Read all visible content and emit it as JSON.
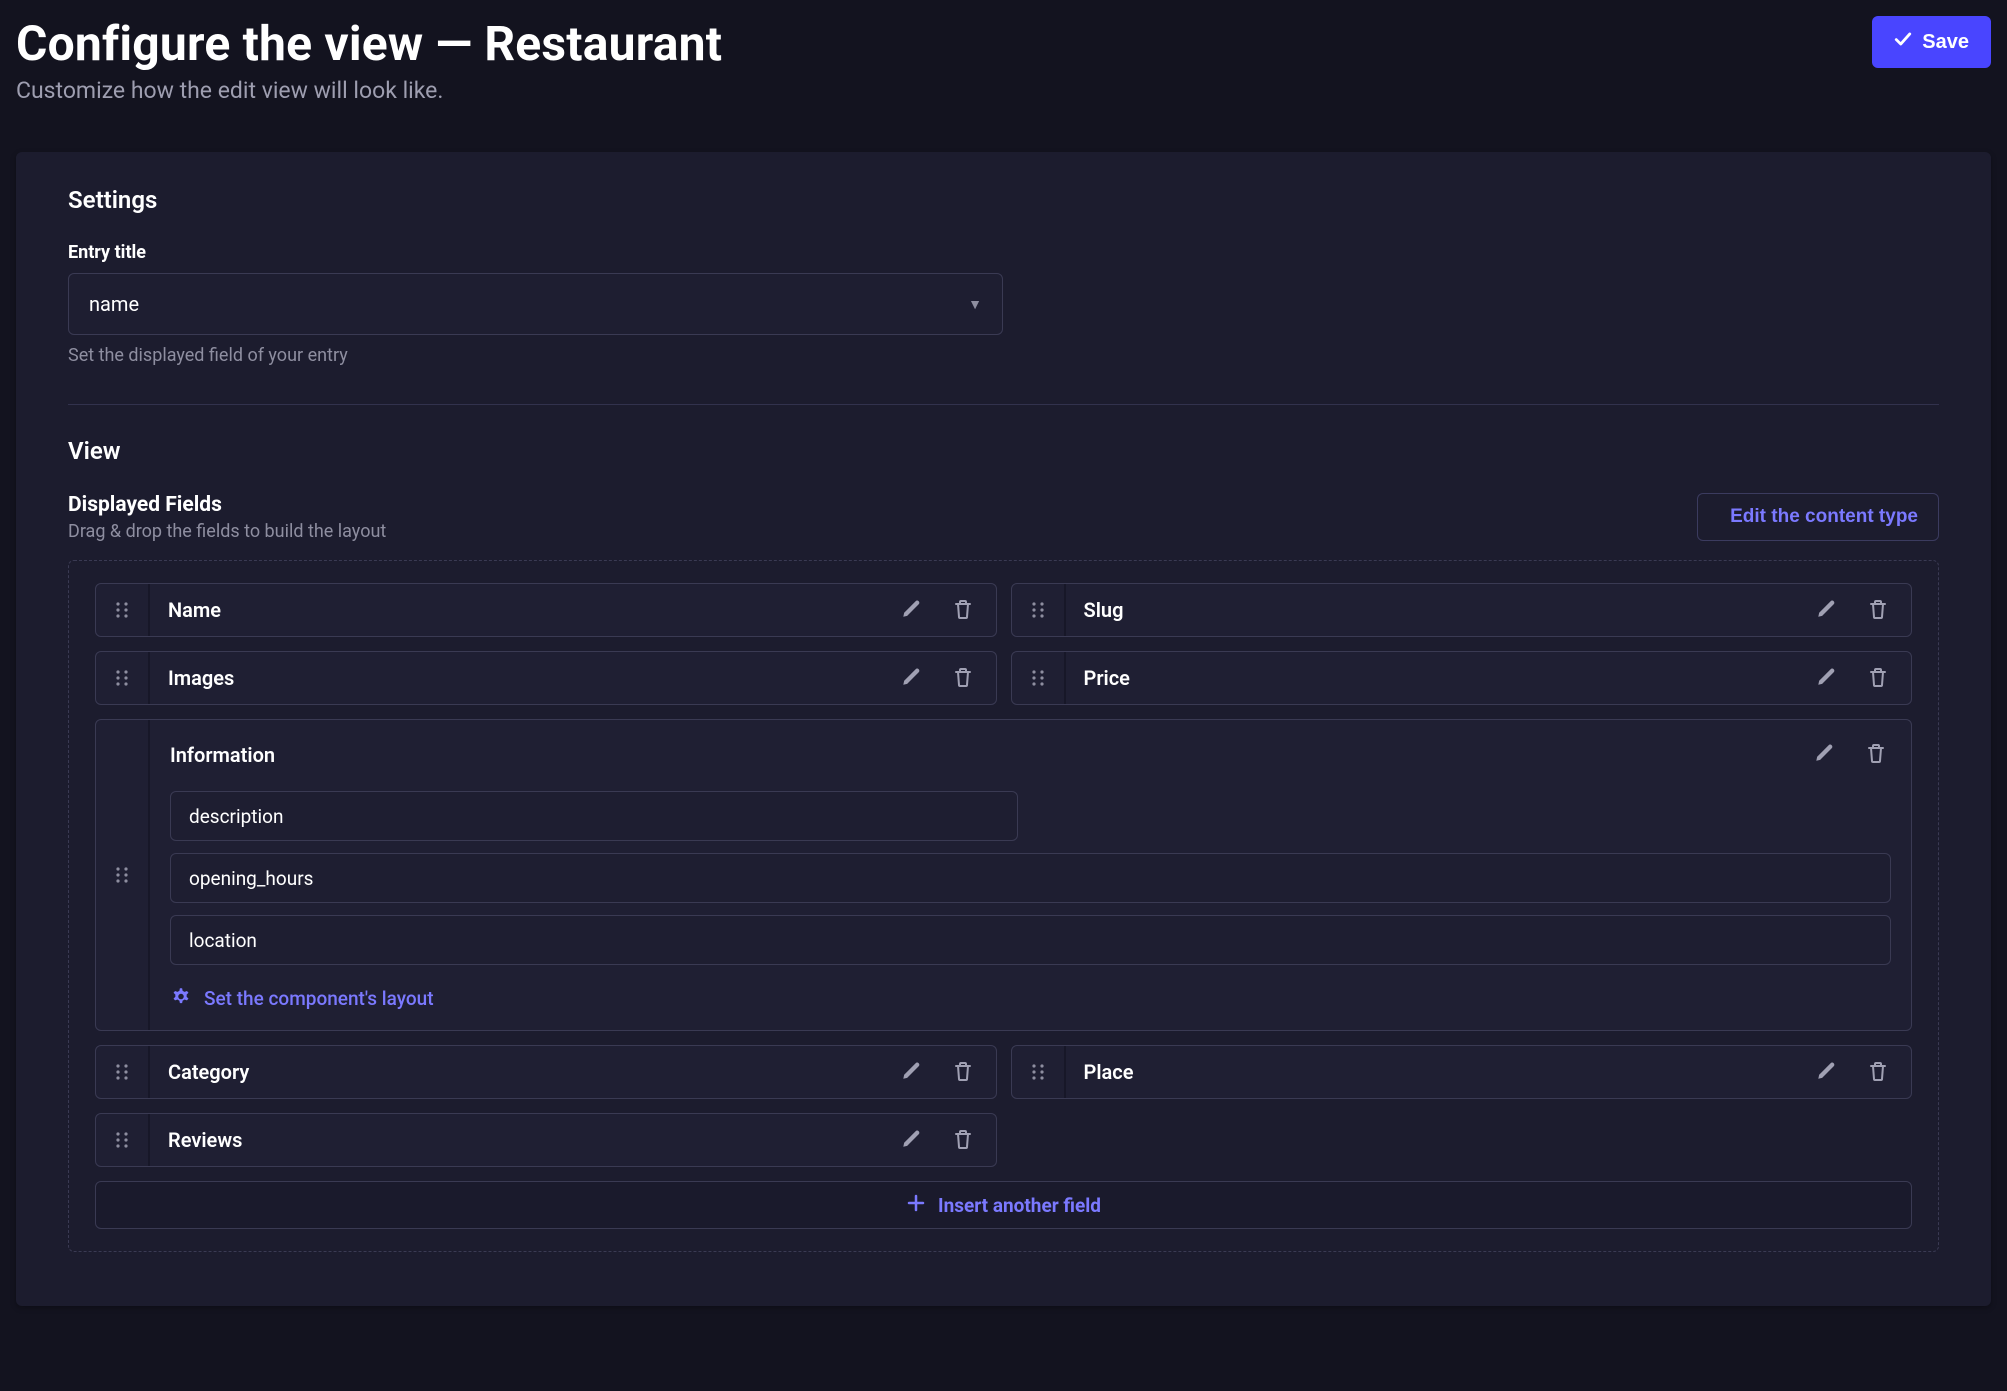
{
  "header": {
    "title": "Configure the view — Restaurant",
    "subtitle": "Customize how the edit view will look like.",
    "save_label": "Save"
  },
  "settings": {
    "heading": "Settings",
    "entry_title_label": "Entry title",
    "entry_title_value": "name",
    "entry_title_hint": "Set the displayed field of your entry"
  },
  "view": {
    "heading": "View",
    "displayed_fields_title": "Displayed Fields",
    "displayed_fields_hint": "Drag & drop the fields to build the layout",
    "edit_content_type_label": "Edit the content type",
    "insert_label": "Insert another field"
  },
  "fields": {
    "row1": {
      "left": "Name",
      "right": "Slug"
    },
    "row2": {
      "left": "Images",
      "right": "Price"
    },
    "component": {
      "title": "Information",
      "sub1": "description",
      "sub2": "opening_hours",
      "sub3": "location",
      "set_layout_label": "Set the component's layout"
    },
    "row3": {
      "left": "Category",
      "right": "Place"
    },
    "row4": {
      "left": "Reviews"
    }
  }
}
